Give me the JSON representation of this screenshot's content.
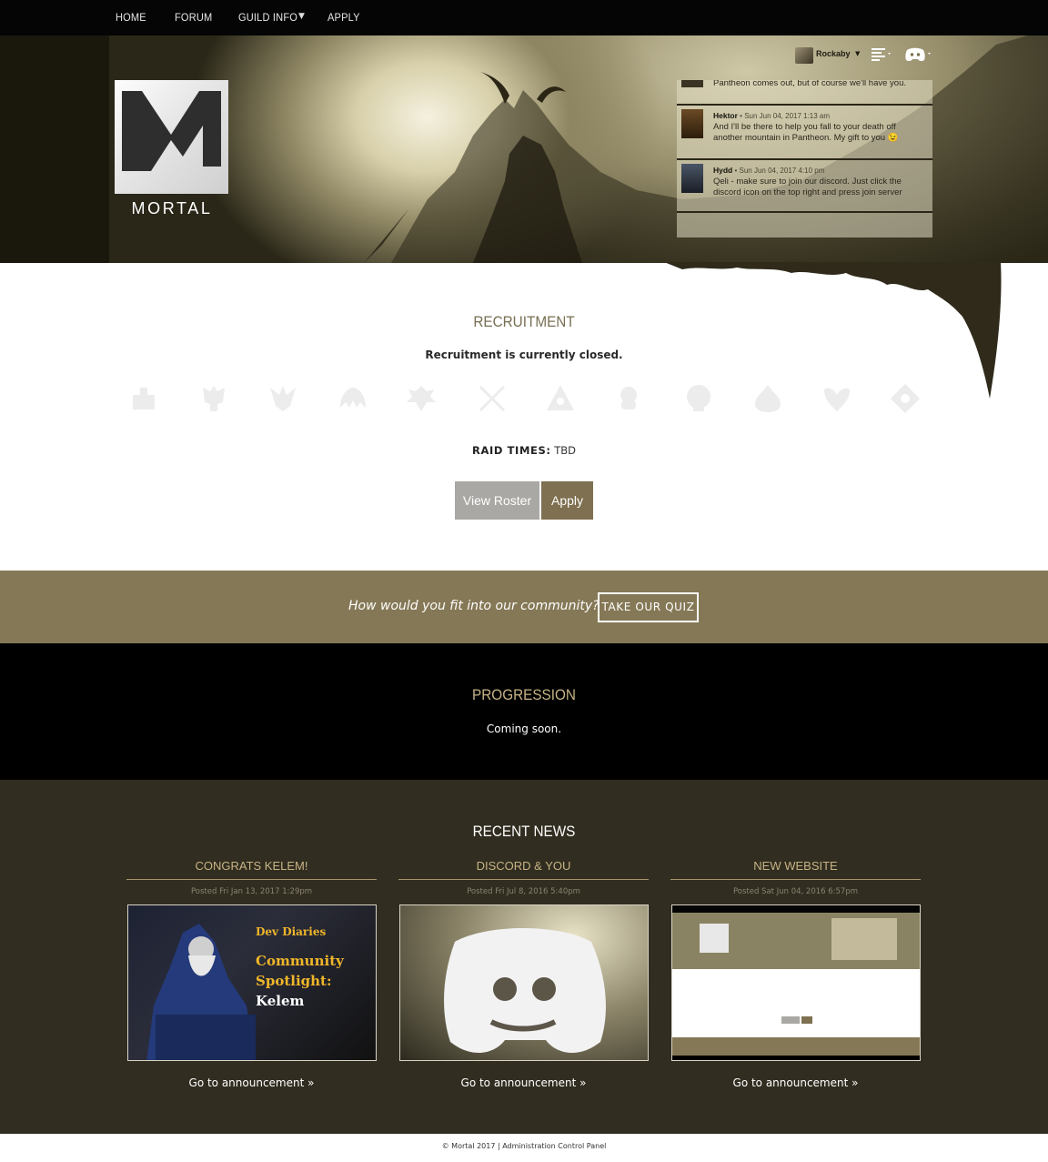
{
  "nav": {
    "home": "HOME",
    "forum": "FORUM",
    "guild_info": "GUILD INFO",
    "apply": "APPLY"
  },
  "header": {
    "logo_text": "MORTAL",
    "username": "Rockaby",
    "icons": [
      "user-avatar",
      "menu-icon",
      "discord-icon"
    ]
  },
  "shoutbox": {
    "messages": [
      {
        "author": "",
        "date": "",
        "text": "Pantheon comes out, but of course we'll have you."
      },
      {
        "author": "Hektor",
        "date": "• Sun Jun 04, 2017 1:13 am",
        "text": "And I'll be there to help you fall to your death off another mountain in Pantheon. My gift to you 😉"
      },
      {
        "author": "Hydd",
        "date": "• Sun Jun 04, 2017 4:10 pm",
        "text": "Qeli - make sure to join our discord. Just click the discord icon on the top right and press join server"
      }
    ]
  },
  "recruitment": {
    "title": "RECRUITMENT",
    "status": "Recruitment is currently closed.",
    "raid_label": "RAID TIMES:",
    "raid_value": "TBD",
    "class_icons": [
      "warrior-icon",
      "paladin-icon",
      "ranger-icon",
      "rogue-icon",
      "shaman-icon",
      "warlord-icon",
      "priest-icon",
      "enchanter-icon",
      "necromancer-icon",
      "druid-icon",
      "wizard-icon",
      "monk-icon"
    ],
    "view_roster": "View Roster",
    "apply": "Apply"
  },
  "quiz": {
    "question": "How would you fit into our community?",
    "button": "TAKE OUR QUIZ"
  },
  "progression": {
    "title": "PROGRESSION",
    "text": "Coming soon."
  },
  "news": {
    "title": "RECENT NEWS",
    "items": [
      {
        "title": "CONGRATS KELEM!",
        "date": "Posted Fri Jan 13, 2017 1:29pm",
        "link": "Go to announcement »",
        "image_text": {
          "line1": "Dev Diaries",
          "line2": "Community",
          "line3": "Spotlight:",
          "line4": "Kelem"
        }
      },
      {
        "title": "DISCORD & YOU",
        "date": "Posted Fri Jul 8, 2016 5:40pm",
        "link": "Go to announcement »"
      },
      {
        "title": "NEW WEBSITE",
        "date": "Posted Sat Jun 04, 2016 6:57pm",
        "link": "Go to announcement »"
      }
    ]
  },
  "footer": {
    "text": "© Mortal 2017 | Administration Control Panel"
  },
  "colors": {
    "accent": "#857856",
    "gold": "#c7b485",
    "dark_olive": "#312d20",
    "nav_bg": "#050505"
  }
}
